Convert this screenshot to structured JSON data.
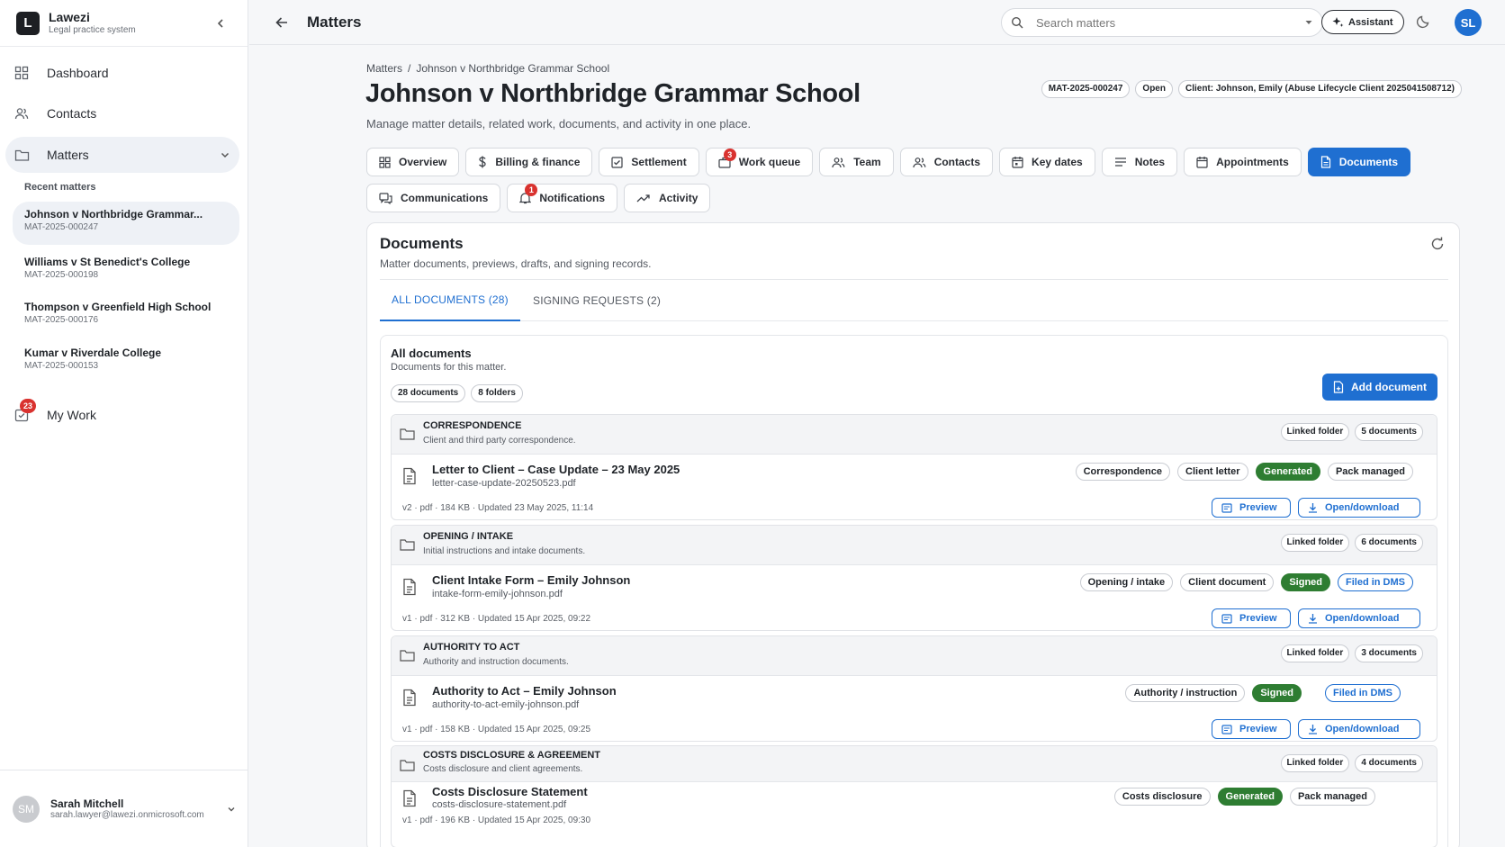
{
  "app": {
    "name": "Lawezi",
    "tagline": "Legal practice system",
    "logo_letter": "L"
  },
  "nav": {
    "dashboard": "Dashboard",
    "contacts": "Contacts",
    "matters": "Matters",
    "my_work": "My Work",
    "my_work_badge": "23"
  },
  "recent": {
    "title": "Recent matters",
    "items": [
      {
        "name": "Johnson v Northbridge Grammar...",
        "number": "MAT-2025-000247"
      },
      {
        "name": "Williams v St Benedict's College",
        "number": "MAT-2025-000198"
      },
      {
        "name": "Thompson v Greenfield High School",
        "number": "MAT-2025-000176"
      },
      {
        "name": "Kumar v Riverdale College",
        "number": "MAT-2025-000153"
      }
    ]
  },
  "user": {
    "initials": "SM",
    "name": "Sarah Mitchell",
    "email": "sarah.lawyer@lawezi.onmicrosoft.com"
  },
  "topbar": {
    "title": "Matters",
    "search_placeholder": "Search matters",
    "assistant": "Assistant",
    "avatar": "SL"
  },
  "breadcrumb": {
    "root": "Matters",
    "separator": "/",
    "current": "Johnson v Northbridge Grammar School"
  },
  "matter": {
    "title": "Johnson v Northbridge Grammar School",
    "subtitle": "Manage matter details, related work, documents, and activity in one place.",
    "number": "MAT-2025-000247",
    "status": "Open",
    "client": "Client: Johnson, Emily (Abuse Lifecycle Client 2025041508712)"
  },
  "tabs": {
    "overview": "Overview",
    "billing": "Billing & finance",
    "settlement": "Settlement",
    "work_queue": "Work queue",
    "work_queue_badge": "3",
    "team": "Team",
    "contacts": "Contacts",
    "key_dates": "Key dates",
    "notes": "Notes",
    "appointments": "Appointments",
    "documents": "Documents",
    "communications": "Communications",
    "notifications": "Notifications",
    "notifications_badge": "1",
    "activity": "Activity"
  },
  "documents": {
    "title": "Documents",
    "subtitle": "Matter documents, previews, drafts, and signing records.",
    "tab_all": "ALL DOCUMENTS (28)",
    "tab_signing": "SIGNING REQUESTS (2)",
    "all_title": "All documents",
    "all_sub": "Documents for this matter.",
    "count_docs": "28 documents",
    "count_folders": "8 folders",
    "add_button": "Add document",
    "preview_label": "Preview",
    "open_label": "Open/download",
    "folders": [
      {
        "name": "CORRESPONDENCE",
        "desc": "Client and third party correspondence.",
        "linked": "Linked folder",
        "count": "5 documents",
        "doc": {
          "name": "Letter to Client – Case Update – 23 May 2025",
          "file": "letter-case-update-20250523.pdf",
          "meta": "v2 · pdf · 184 KB · Updated 23 May 2025, 11:14",
          "chips": [
            "Correspondence",
            "Client letter",
            "Generated",
            "Pack managed"
          ]
        }
      },
      {
        "name": "OPENING / INTAKE",
        "desc": "Initial instructions and intake documents.",
        "linked": "Linked folder",
        "count": "6 documents",
        "doc": {
          "name": "Client Intake Form – Emily Johnson",
          "file": "intake-form-emily-johnson.pdf",
          "meta": "v1 · pdf · 312 KB · Updated 15 Apr 2025, 09:22",
          "chips": [
            "Opening / intake",
            "Client document",
            "Signed",
            "Filed in DMS"
          ]
        }
      },
      {
        "name": "AUTHORITY TO ACT",
        "desc": "Authority and instruction documents.",
        "linked": "Linked folder",
        "count": "3 documents",
        "doc": {
          "name": "Authority to Act – Emily Johnson",
          "file": "authority-to-act-emily-johnson.pdf",
          "meta": "v1 · pdf · 158 KB · Updated 15 Apr 2025, 09:25",
          "chips": [
            "Authority / instruction",
            "Signed",
            "Filed in DMS"
          ]
        }
      },
      {
        "name": "COSTS DISCLOSURE & AGREEMENT",
        "desc": "Costs disclosure and client agreements.",
        "linked": "Linked folder",
        "count": "4 documents",
        "doc": {
          "name": "Costs Disclosure Statement",
          "file": "costs-disclosure-statement.pdf",
          "meta": "v1 · pdf · 196 KB · Updated 15 Apr 2025, 09:30",
          "chips": [
            "Costs disclosure",
            "Generated",
            "Pack managed"
          ]
        }
      }
    ]
  },
  "colors": {
    "accent": "#1f6fd1",
    "success": "#2e7d32",
    "danger": "#d9322f"
  },
  "icons": {
    "dashboard": "grid-icon",
    "contacts": "people-icon",
    "matters": "folder-icon",
    "my_work": "inbox-check-icon",
    "search": "search-icon",
    "assistant": "sparkle-icon",
    "theme": "moon-icon",
    "refresh": "refresh-icon",
    "file": "file-icon",
    "preview": "preview-icon",
    "download": "download-icon"
  }
}
